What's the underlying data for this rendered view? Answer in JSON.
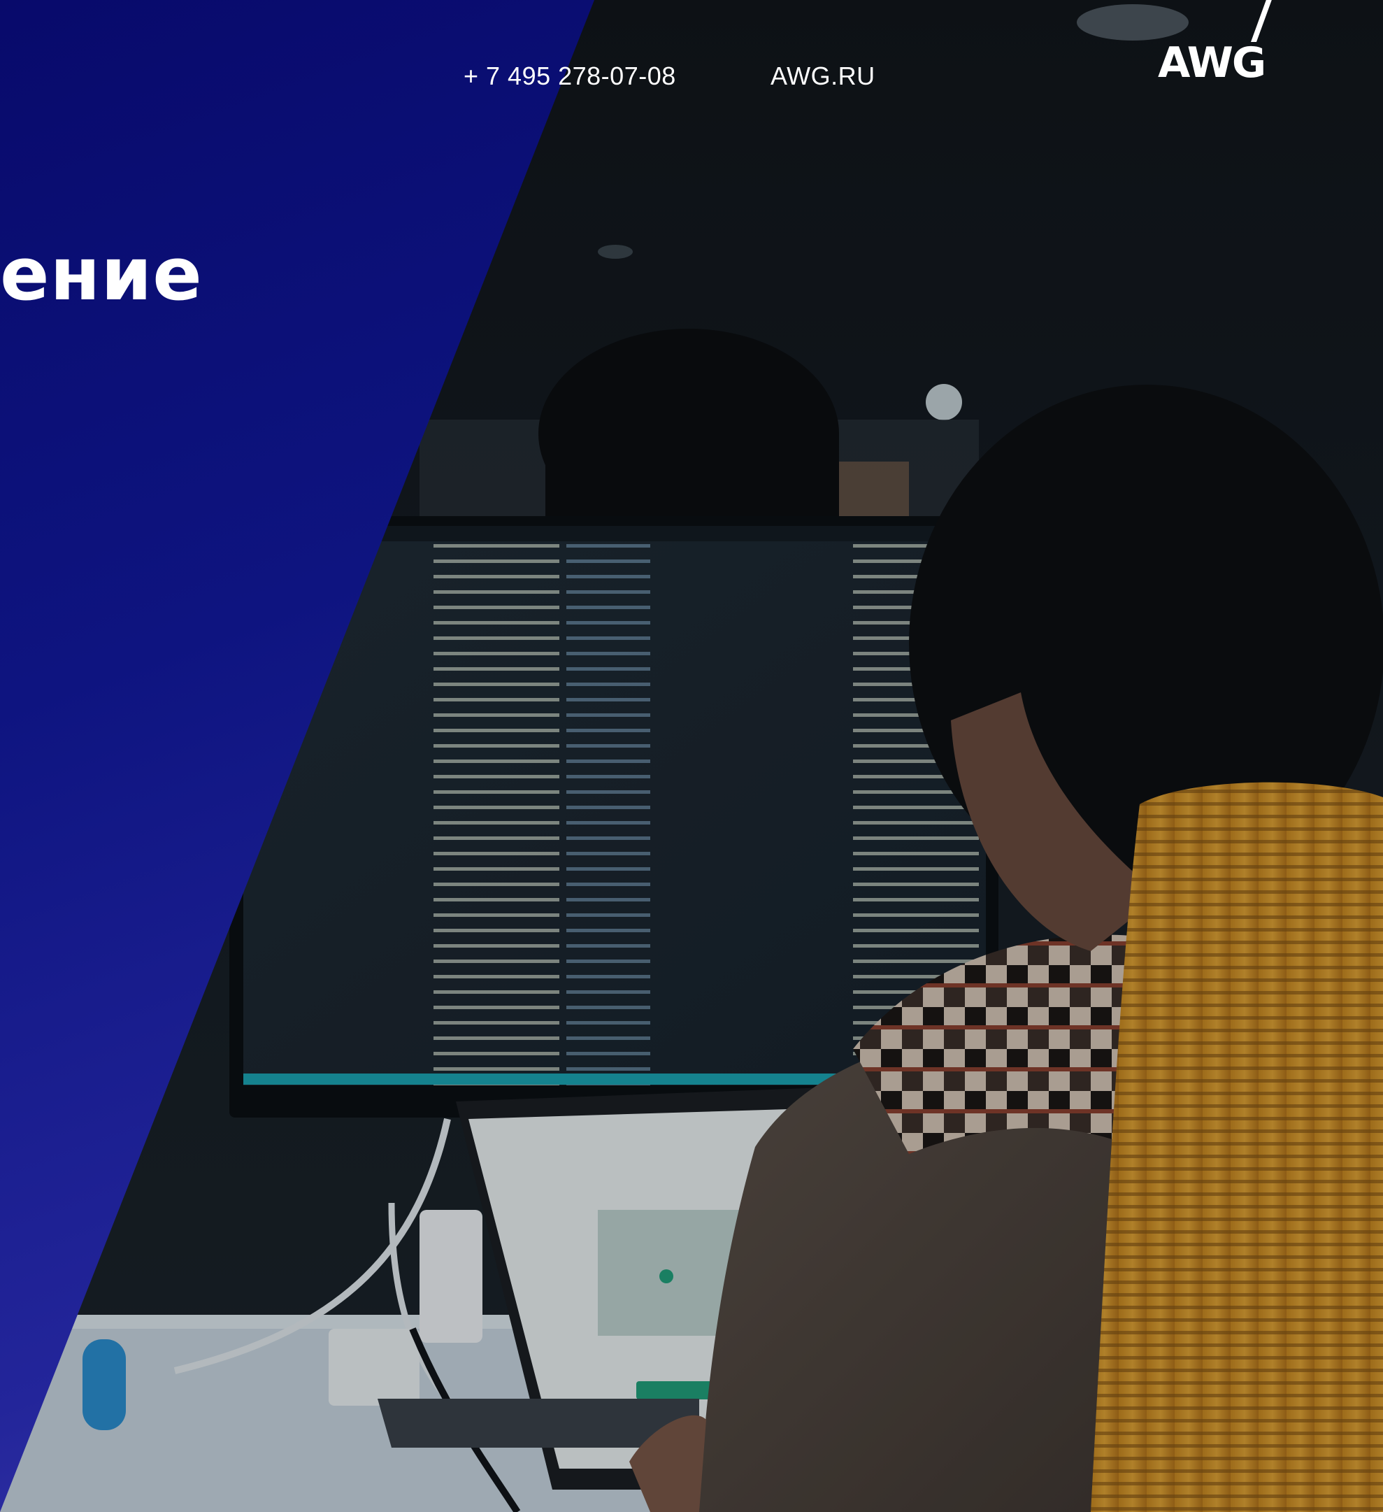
{
  "header": {
    "phone": "+ 7 495 278-07-08",
    "site": "AWG.RU",
    "logo_text": "AWG"
  },
  "hero": {
    "headline": "ение"
  },
  "colors": {
    "panel_dark": "#080a6b",
    "panel_light": "#4a47b5",
    "text": "#ffffff"
  },
  "background": {
    "icon": "developer-photo"
  }
}
